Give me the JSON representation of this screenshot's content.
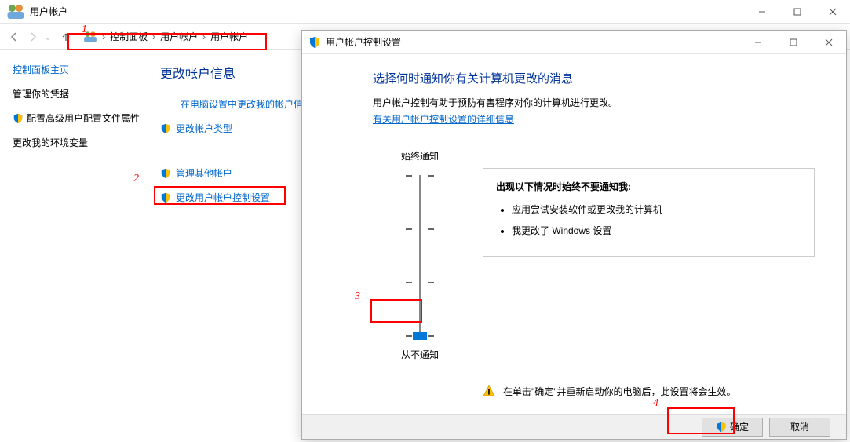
{
  "main_window": {
    "title": "用户帐户",
    "breadcrumb": [
      "控制面板",
      "用户帐户",
      "用户帐户"
    ]
  },
  "sidebar": {
    "home": "控制面板主页",
    "items": [
      {
        "label": "管理你的凭据",
        "shield": false,
        "plain": true
      },
      {
        "label": "配置高级用户配置文件属性",
        "shield": true,
        "plain": true
      },
      {
        "label": "更改我的环境变量",
        "shield": false,
        "plain": true
      }
    ]
  },
  "content": {
    "heading": "更改帐户信息",
    "options": [
      {
        "label": "在电脑设置中更改我的帐户信息",
        "shield": false,
        "indent": true
      },
      {
        "label": "更改帐户类型",
        "shield": true,
        "indent": false
      },
      {
        "label": "管理其他帐户",
        "shield": true,
        "indent": false
      },
      {
        "label": "更改用户帐户控制设置",
        "shield": true,
        "indent": false
      }
    ]
  },
  "dialog": {
    "title": "用户帐户控制设置",
    "heading": "选择何时通知你有关计算机更改的消息",
    "desc": "用户帐户控制有助于预防有害程序对你的计算机进行更改。",
    "learn_more": "有关用户帐户控制设置的详细信息",
    "slider_top": "始终通知",
    "slider_bottom": "从不通知",
    "slider_level": 0,
    "info_heading": "出现以下情况时始终不要通知我:",
    "info_items": [
      "应用尝试安装软件或更改我的计算机",
      "我更改了 Windows 设置"
    ],
    "warning": "在单击\"确定\"并重新启动你的电脑后，此设置将会生效。",
    "ok": "确定",
    "cancel": "取消"
  },
  "annotations": {
    "m1": "1",
    "m2": "2",
    "m3": "3",
    "m4": "4"
  }
}
